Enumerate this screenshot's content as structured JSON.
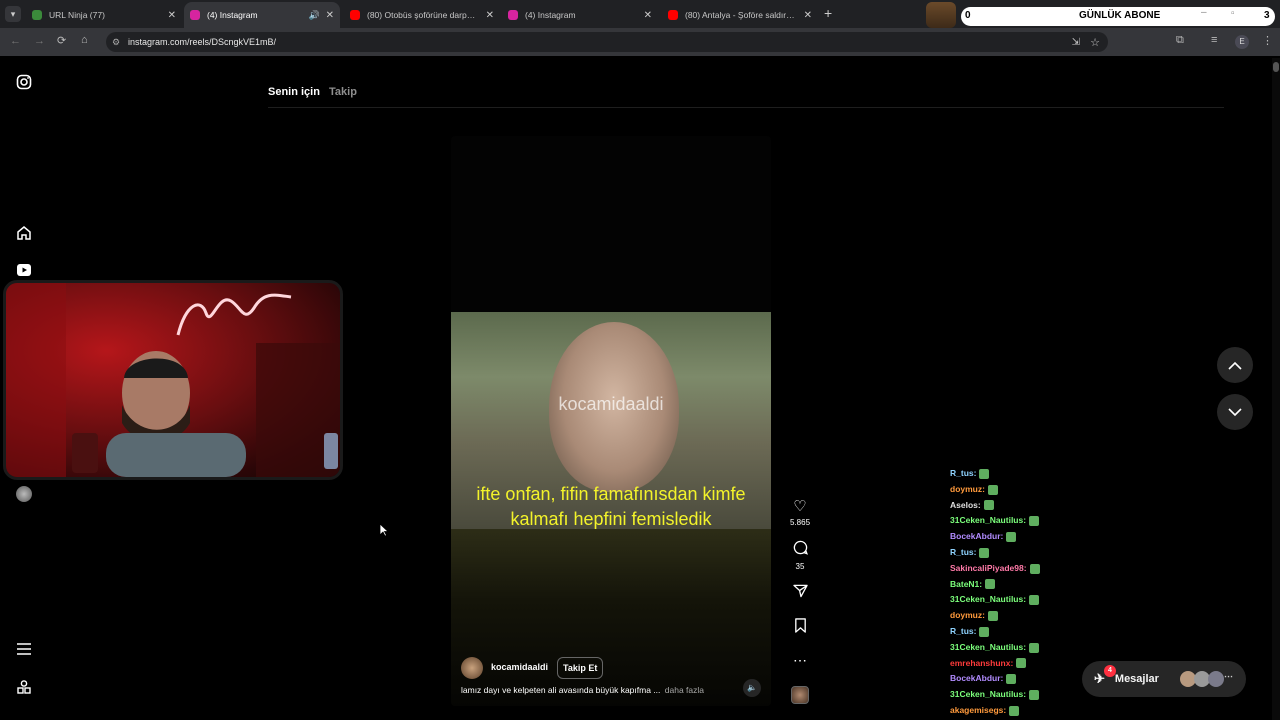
{
  "browser": {
    "tabs": [
      {
        "label": "URL Ninja (77)",
        "fav_color": "#3b8a3b"
      },
      {
        "label": "(4) Instagram",
        "fav_color": "#d6249f"
      },
      {
        "label": "(80) Otobüs şoförüne darp, ara...",
        "fav_color": "#ff0000"
      },
      {
        "label": "(4) Instagram",
        "fav_color": "#d6249f"
      },
      {
        "label": "(80) Antalya - Şoföre saldırıp ta...",
        "fav_color": "#ff0000"
      }
    ],
    "new_tab": "+",
    "url": "instagram.com/reels/DScngkVE1mB/",
    "profile_initial": "E"
  },
  "overlay": {
    "abone_count": "0",
    "abone_label": "GÜNLÜK ABONE",
    "abone_right": "3"
  },
  "feed": {
    "tab_for_you": "Senin için",
    "tab_following": "Takip"
  },
  "reel": {
    "watermark": "kocamidaaldi",
    "subtitle_line1": "ifte onfan, fifin famafınısdan kimfe",
    "subtitle_line2": "kalmafı hepfini femisledik",
    "username": "kocamidaaldi",
    "follow_label": "Takip Et",
    "caption": "lamız dayı ve kelpeten ali avasında büyük kapıfma ...",
    "more_label": "daha fazla",
    "likes": "5.865",
    "comments": "35"
  },
  "messages": {
    "label": "Mesajlar",
    "badge": "4"
  },
  "chat": [
    {
      "user": "R_tus:",
      "color": "#8fd3ff"
    },
    {
      "user": "doymuz:",
      "color": "#ff9a3c"
    },
    {
      "user": "Aselos:",
      "color": "#e0e0e0"
    },
    {
      "user": "31Ceken_Nautilus:",
      "color": "#7cff7c"
    },
    {
      "user": "BocekAbdur:",
      "color": "#b28cff"
    },
    {
      "user": "R_tus:",
      "color": "#8fd3ff"
    },
    {
      "user": "SakincaliPiyade98:",
      "color": "#ff7aa8"
    },
    {
      "user": "BateN1:",
      "color": "#7cff7c"
    },
    {
      "user": "31Ceken_Nautilus:",
      "color": "#7cff7c"
    },
    {
      "user": "doymuz:",
      "color": "#ff9a3c"
    },
    {
      "user": "R_tus:",
      "color": "#8fd3ff"
    },
    {
      "user": "31Ceken_Nautilus:",
      "color": "#7cff7c"
    },
    {
      "user": "emrehanshunx:",
      "color": "#ff3b3b"
    },
    {
      "user": "BocekAbdur:",
      "color": "#b28cff"
    },
    {
      "user": "31Ceken_Nautilus:",
      "color": "#7cff7c"
    },
    {
      "user": "akagemisegs:",
      "color": "#ff9a3c"
    }
  ]
}
